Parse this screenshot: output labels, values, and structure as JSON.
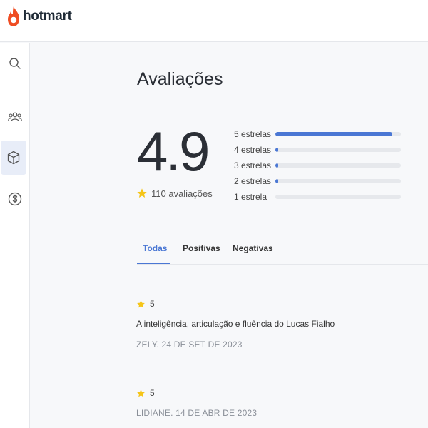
{
  "brand": {
    "name": "hotmart"
  },
  "sidebar": {
    "items": [
      {
        "icon": "search-icon"
      },
      {
        "icon": "users-icon"
      },
      {
        "icon": "box-icon",
        "active": true
      },
      {
        "icon": "dollar-icon"
      }
    ]
  },
  "page": {
    "title": "Avaliações",
    "score": "4.9",
    "count_label": "110 avaliações"
  },
  "distribution": [
    {
      "label": "5 estrelas",
      "fraction": 0.93
    },
    {
      "label": "4 estrelas",
      "fraction": 0.02
    },
    {
      "label": "3 estrelas",
      "fraction": 0.02
    },
    {
      "label": "2 estrelas",
      "fraction": 0.02
    },
    {
      "label": "1 estrela",
      "fraction": 0
    }
  ],
  "tabs": [
    {
      "label": "Todas",
      "active": true
    },
    {
      "label": "Positivas"
    },
    {
      "label": "Negativas"
    }
  ],
  "reviews": [
    {
      "rating": "5",
      "text": "A inteligência, articulação e fluência do Lucas Fialho",
      "meta": "ZELY. 24 DE SET DE 2023"
    },
    {
      "rating": "5",
      "text": "",
      "meta": "LIDIANE. 14 DE ABR DE 2023"
    }
  ],
  "colors": {
    "accent": "#4a77d4",
    "star": "#f5c518",
    "brand": "#ef4d23"
  }
}
